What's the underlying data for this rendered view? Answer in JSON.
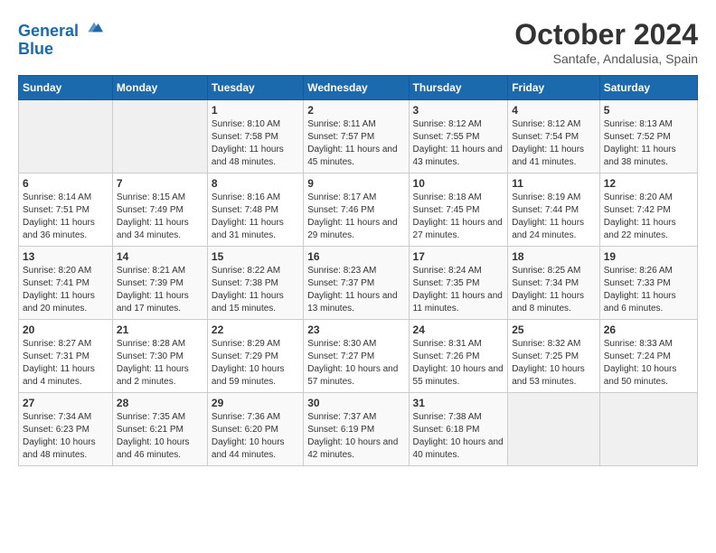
{
  "header": {
    "logo": {
      "line1": "General",
      "line2": "Blue"
    },
    "title": "October 2024",
    "subtitle": "Santafe, Andalusia, Spain"
  },
  "weekdays": [
    "Sunday",
    "Monday",
    "Tuesday",
    "Wednesday",
    "Thursday",
    "Friday",
    "Saturday"
  ],
  "weeks": [
    [
      {
        "day": "",
        "empty": true
      },
      {
        "day": "",
        "empty": true
      },
      {
        "day": "1",
        "sunrise": "8:10 AM",
        "sunset": "7:58 PM",
        "daylight": "11 hours and 48 minutes."
      },
      {
        "day": "2",
        "sunrise": "8:11 AM",
        "sunset": "7:57 PM",
        "daylight": "11 hours and 45 minutes."
      },
      {
        "day": "3",
        "sunrise": "8:12 AM",
        "sunset": "7:55 PM",
        "daylight": "11 hours and 43 minutes."
      },
      {
        "day": "4",
        "sunrise": "8:12 AM",
        "sunset": "7:54 PM",
        "daylight": "11 hours and 41 minutes."
      },
      {
        "day": "5",
        "sunrise": "8:13 AM",
        "sunset": "7:52 PM",
        "daylight": "11 hours and 38 minutes."
      }
    ],
    [
      {
        "day": "6",
        "sunrise": "8:14 AM",
        "sunset": "7:51 PM",
        "daylight": "11 hours and 36 minutes."
      },
      {
        "day": "7",
        "sunrise": "8:15 AM",
        "sunset": "7:49 PM",
        "daylight": "11 hours and 34 minutes."
      },
      {
        "day": "8",
        "sunrise": "8:16 AM",
        "sunset": "7:48 PM",
        "daylight": "11 hours and 31 minutes."
      },
      {
        "day": "9",
        "sunrise": "8:17 AM",
        "sunset": "7:46 PM",
        "daylight": "11 hours and 29 minutes."
      },
      {
        "day": "10",
        "sunrise": "8:18 AM",
        "sunset": "7:45 PM",
        "daylight": "11 hours and 27 minutes."
      },
      {
        "day": "11",
        "sunrise": "8:19 AM",
        "sunset": "7:44 PM",
        "daylight": "11 hours and 24 minutes."
      },
      {
        "day": "12",
        "sunrise": "8:20 AM",
        "sunset": "7:42 PM",
        "daylight": "11 hours and 22 minutes."
      }
    ],
    [
      {
        "day": "13",
        "sunrise": "8:20 AM",
        "sunset": "7:41 PM",
        "daylight": "11 hours and 20 minutes."
      },
      {
        "day": "14",
        "sunrise": "8:21 AM",
        "sunset": "7:39 PM",
        "daylight": "11 hours and 17 minutes."
      },
      {
        "day": "15",
        "sunrise": "8:22 AM",
        "sunset": "7:38 PM",
        "daylight": "11 hours and 15 minutes."
      },
      {
        "day": "16",
        "sunrise": "8:23 AM",
        "sunset": "7:37 PM",
        "daylight": "11 hours and 13 minutes."
      },
      {
        "day": "17",
        "sunrise": "8:24 AM",
        "sunset": "7:35 PM",
        "daylight": "11 hours and 11 minutes."
      },
      {
        "day": "18",
        "sunrise": "8:25 AM",
        "sunset": "7:34 PM",
        "daylight": "11 hours and 8 minutes."
      },
      {
        "day": "19",
        "sunrise": "8:26 AM",
        "sunset": "7:33 PM",
        "daylight": "11 hours and 6 minutes."
      }
    ],
    [
      {
        "day": "20",
        "sunrise": "8:27 AM",
        "sunset": "7:31 PM",
        "daylight": "11 hours and 4 minutes."
      },
      {
        "day": "21",
        "sunrise": "8:28 AM",
        "sunset": "7:30 PM",
        "daylight": "11 hours and 2 minutes."
      },
      {
        "day": "22",
        "sunrise": "8:29 AM",
        "sunset": "7:29 PM",
        "daylight": "10 hours and 59 minutes."
      },
      {
        "day": "23",
        "sunrise": "8:30 AM",
        "sunset": "7:27 PM",
        "daylight": "10 hours and 57 minutes."
      },
      {
        "day": "24",
        "sunrise": "8:31 AM",
        "sunset": "7:26 PM",
        "daylight": "10 hours and 55 minutes."
      },
      {
        "day": "25",
        "sunrise": "8:32 AM",
        "sunset": "7:25 PM",
        "daylight": "10 hours and 53 minutes."
      },
      {
        "day": "26",
        "sunrise": "8:33 AM",
        "sunset": "7:24 PM",
        "daylight": "10 hours and 50 minutes."
      }
    ],
    [
      {
        "day": "27",
        "sunrise": "7:34 AM",
        "sunset": "6:23 PM",
        "daylight": "10 hours and 48 minutes."
      },
      {
        "day": "28",
        "sunrise": "7:35 AM",
        "sunset": "6:21 PM",
        "daylight": "10 hours and 46 minutes."
      },
      {
        "day": "29",
        "sunrise": "7:36 AM",
        "sunset": "6:20 PM",
        "daylight": "10 hours and 44 minutes."
      },
      {
        "day": "30",
        "sunrise": "7:37 AM",
        "sunset": "6:19 PM",
        "daylight": "10 hours and 42 minutes."
      },
      {
        "day": "31",
        "sunrise": "7:38 AM",
        "sunset": "6:18 PM",
        "daylight": "10 hours and 40 minutes."
      },
      {
        "day": "",
        "empty": true
      },
      {
        "day": "",
        "empty": true
      }
    ]
  ]
}
